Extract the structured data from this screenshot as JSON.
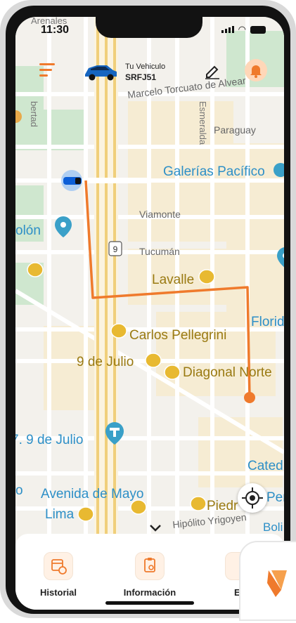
{
  "status_bar": {
    "time": "11:30"
  },
  "header": {
    "vehicle_title": "Tu Vehiculo",
    "vehicle_plate": "SRFJ51"
  },
  "map": {
    "labels": {
      "arenales": "Arenales",
      "libertad": "bertad",
      "marcelo": "Marcelo Torcuato de Alvear",
      "esmeralda": "Esmeralda",
      "paraguay": "Paraguay",
      "galerias": "Galerías Pacífico",
      "viamonte": "Viamonte",
      "colon": "olón",
      "route9": "9",
      "tucuman": "Tucumán",
      "lavalle": "Lavalle",
      "florida": "Florida",
      "carlos": "Carlos Pellegrini",
      "nueve_julio_station": "9 de Julio",
      "diagonal": "Diagonal Norte",
      "nueve_julio_ave": "7. 9 de Julio",
      "catedral": "Catedr",
      "avenida_mayo": "Avenida de Mayo",
      "lima": "Lima",
      "piedras": "Piedr",
      "peru": "Per",
      "hipolito": "Hipólito Yrigoyen",
      "bolivar": "Boli",
      "o_edge": "o"
    }
  },
  "bottom_nav": {
    "items": [
      {
        "label": "Historial",
        "icon": "calendar-clock-icon"
      },
      {
        "label": "Información",
        "icon": "clipboard-search-icon"
      },
      {
        "label": "Es",
        "icon": "partial-icon"
      }
    ]
  },
  "colors": {
    "accent": "#ef7a2c",
    "route": "#ef7a2c",
    "transit": "#e8b931",
    "water_blue": "#3aa0c8",
    "park_green": "#cfe7cf"
  }
}
